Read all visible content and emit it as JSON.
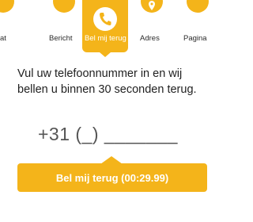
{
  "tabs": [
    {
      "label": "at",
      "icon": "chat-icon"
    },
    {
      "label": "Bericht",
      "icon": "message-icon"
    },
    {
      "label": "Bel mij terug",
      "icon": "phone-icon",
      "active": true
    },
    {
      "label": "Adres",
      "icon": "location-pin-icon"
    },
    {
      "label": "Pagina",
      "icon": "page-icon"
    }
  ],
  "message": "Vul uw telefoonnummer in en wij bellen u binnen 30 seconden terug.",
  "phone_display": "+31 (_) _______",
  "cta_label": "Bel mij terug (00:29.99)",
  "colors": {
    "accent": "#f4b41a",
    "text": "#1f1f1f"
  }
}
